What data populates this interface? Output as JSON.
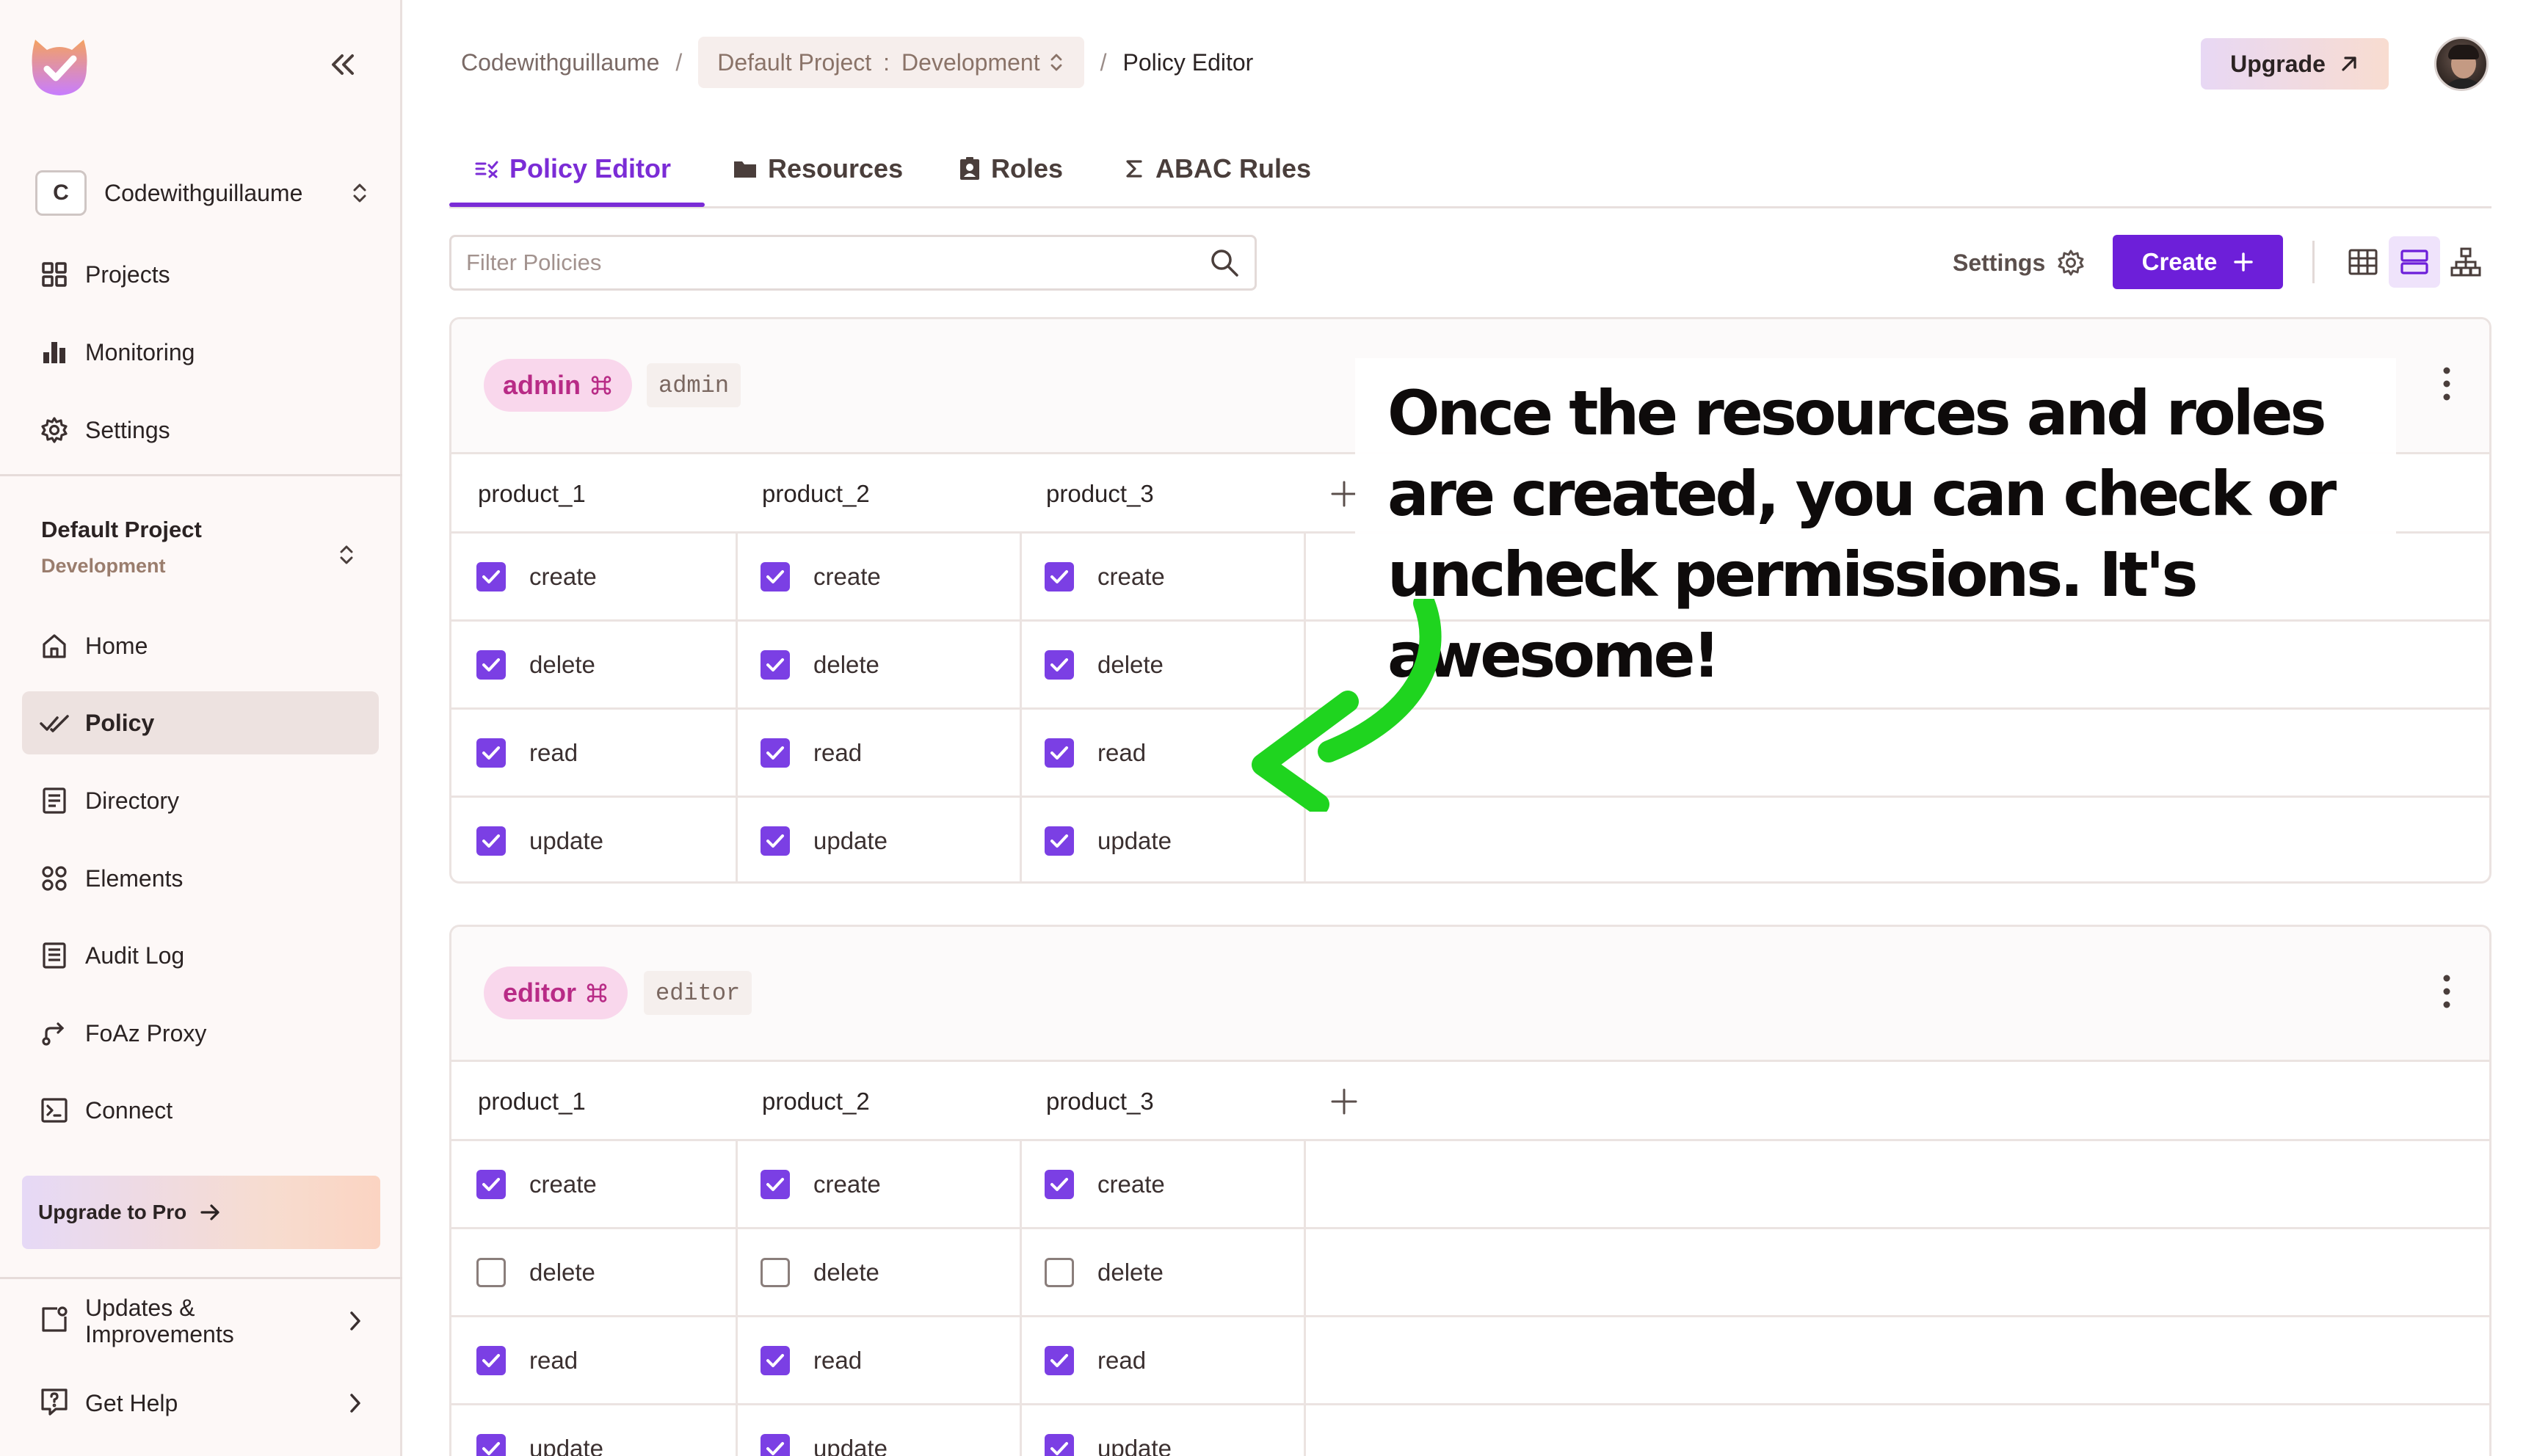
{
  "sidebar": {
    "org": {
      "initial": "C",
      "name": "Codewithguillaume"
    },
    "top_nav": [
      {
        "label": "Projects",
        "icon": "grid-icon"
      },
      {
        "label": "Monitoring",
        "icon": "bar-chart-icon"
      },
      {
        "label": "Settings",
        "icon": "gear-icon"
      }
    ],
    "project": {
      "name": "Default Project",
      "env": "Development"
    },
    "project_nav": [
      {
        "label": "Home",
        "icon": "home-icon"
      },
      {
        "label": "Policy",
        "icon": "policy-check-icon",
        "active": true
      },
      {
        "label": "Directory",
        "icon": "directory-icon"
      },
      {
        "label": "Elements",
        "icon": "elements-icon"
      },
      {
        "label": "Audit Log",
        "icon": "audit-log-icon"
      },
      {
        "label": "FoAz Proxy",
        "icon": "proxy-icon"
      },
      {
        "label": "Connect",
        "icon": "terminal-icon"
      }
    ],
    "upgrade_pro": "Upgrade to Pro",
    "updates_line1": "Updates &",
    "updates_line2": "Improvements",
    "help": "Get Help"
  },
  "header": {
    "breadcrumb_org": "Codewithguillaume",
    "breadcrumb_project": "Default Project",
    "breadcrumb_env": "Development",
    "breadcrumb_page": "Policy Editor",
    "upgrade_label": "Upgrade"
  },
  "tabs": [
    {
      "label": "Policy Editor",
      "icon": "policy-editor-icon",
      "active": true
    },
    {
      "label": "Resources",
      "icon": "folder-icon"
    },
    {
      "label": "Roles",
      "icon": "id-card-icon"
    },
    {
      "label": "ABAC Rules",
      "icon": "sigma-icon"
    }
  ],
  "toolbar": {
    "filter_placeholder": "Filter Policies",
    "settings_label": "Settings",
    "create_label": "Create"
  },
  "policies": [
    {
      "role_name": "admin",
      "role_key": "admin",
      "resources": [
        "product_1",
        "product_2",
        "product_3"
      ],
      "actions": [
        "create",
        "delete",
        "read",
        "update"
      ],
      "checked": [
        [
          true,
          true,
          true,
          true
        ],
        [
          true,
          true,
          true,
          true
        ],
        [
          true,
          true,
          true,
          true
        ]
      ]
    },
    {
      "role_name": "editor",
      "role_key": "editor",
      "resources": [
        "product_1",
        "product_2",
        "product_3"
      ],
      "actions": [
        "create",
        "delete",
        "read",
        "update"
      ],
      "checked": [
        [
          true,
          false,
          true,
          true
        ],
        [
          true,
          false,
          true,
          true
        ],
        [
          true,
          false,
          true,
          true
        ]
      ]
    }
  ],
  "annotation": {
    "text": "Once the resources and roles are created, you can check or uncheck permissions. It's awesome!",
    "arrow_color": "#1fd41f"
  },
  "colors": {
    "accent": "#6d1fd9",
    "role_pill_bg": "#f9d7ec",
    "role_pill_text": "#b82b86",
    "checkbox_on": "#7b3fe4"
  }
}
